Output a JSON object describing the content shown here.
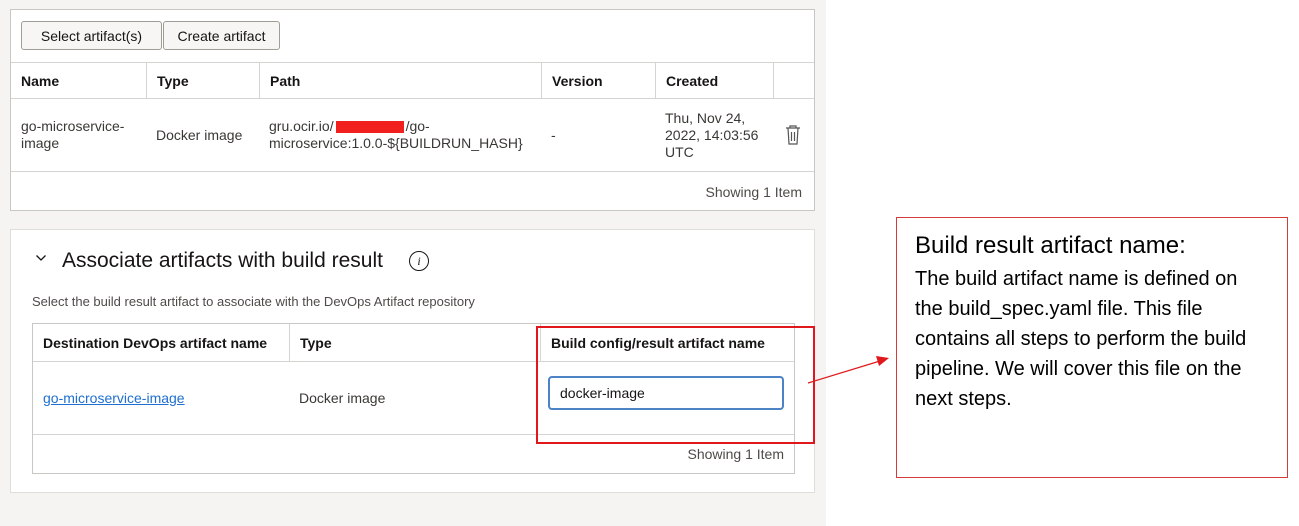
{
  "artifacts": {
    "select_button": "Select artifact(s)",
    "create_button": "Create artifact",
    "columns": [
      "Name",
      "Type",
      "Path",
      "Version",
      "Created"
    ],
    "row": {
      "name": "go-microservice-image",
      "type": "Docker image",
      "path_prefix": "gru.ocir.io/",
      "path_suffix": "/go-microservice:1.0.0-${BUILDRUN_HASH}",
      "version": "-",
      "created": "Thu, Nov 24, 2022, 14:03:56 UTC"
    },
    "footer": "Showing 1 Item"
  },
  "associate": {
    "title": "Associate artifacts with build result",
    "info_icon": "i",
    "description": "Select the build result artifact to associate with the DevOps Artifact repository",
    "columns": [
      "Destination DevOps artifact name",
      "Type",
      "Build config/result artifact name"
    ],
    "row": {
      "destination": "go-microservice-image",
      "type": "Docker image",
      "result_name": "docker-image"
    },
    "footer": "Showing 1 Item"
  },
  "annotation": {
    "title": "Build result artifact name:",
    "body": "The build artifact name is defined on the build_spec.yaml file. This file contains all steps to perform the build pipeline. We will cover this file on the next steps."
  },
  "colors": {
    "highlight": "#e0181b",
    "link": "#1e6fcf",
    "redaction": "#f21f1f"
  }
}
